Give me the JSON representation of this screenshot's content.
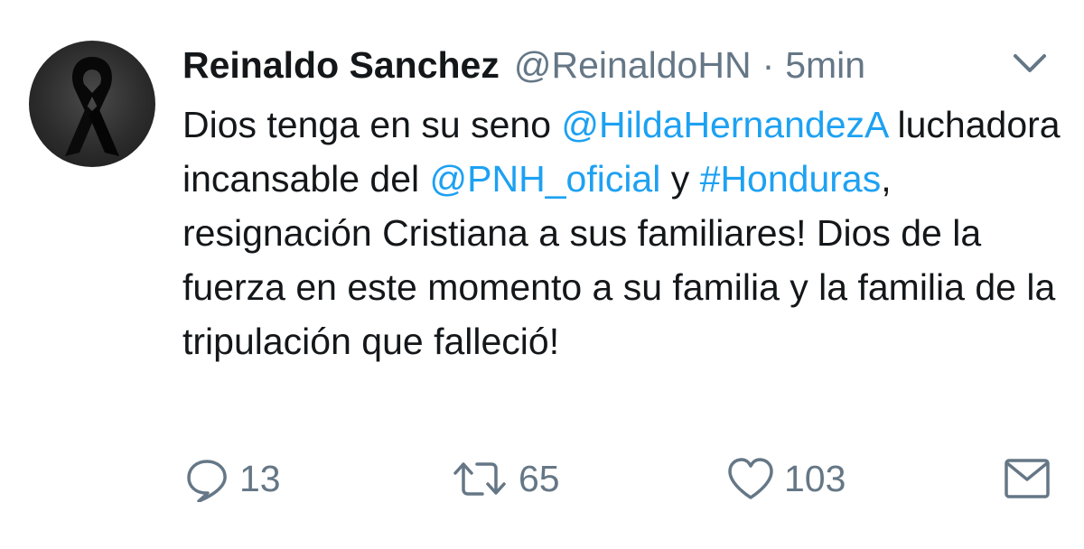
{
  "tweet": {
    "display_name": "Reinaldo Sanchez",
    "handle": "@ReinaldoHN",
    "separator": "·",
    "time": "5min",
    "text": {
      "p1": "Dios tenga en su seno ",
      "mention1": "@HildaHernandezA",
      "p2": " luchadora incansable del ",
      "mention2": "@PNH_oficial",
      "p3": " y ",
      "hashtag": "#Honduras",
      "p4": ", resignación Cristiana a sus familiares! Dios de la fuerza en este momento a su familia y la familia de la tripulación que falleció!"
    },
    "actions": {
      "reply_count": "13",
      "retweet_count": "65",
      "like_count": "103"
    },
    "icons": {
      "avatar": "black-mourning-ribbon",
      "caret": "chevron-down-icon",
      "reply": "reply-icon",
      "retweet": "retweet-icon",
      "like": "heart-icon",
      "dm": "envelope-icon"
    },
    "colors": {
      "text": "#14171a",
      "secondary": "#657786",
      "link": "#1da1f2",
      "background": "#ffffff"
    }
  }
}
